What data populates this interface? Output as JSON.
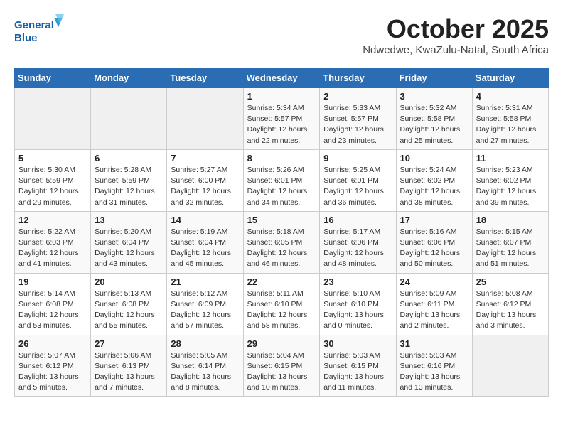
{
  "header": {
    "logo_line1": "General",
    "logo_line2": "Blue",
    "month": "October 2025",
    "location": "Ndwedwe, KwaZulu-Natal, South Africa"
  },
  "weekdays": [
    "Sunday",
    "Monday",
    "Tuesday",
    "Wednesday",
    "Thursday",
    "Friday",
    "Saturday"
  ],
  "weeks": [
    [
      {
        "day": "",
        "info": ""
      },
      {
        "day": "",
        "info": ""
      },
      {
        "day": "",
        "info": ""
      },
      {
        "day": "1",
        "info": "Sunrise: 5:34 AM\nSunset: 5:57 PM\nDaylight: 12 hours\nand 22 minutes."
      },
      {
        "day": "2",
        "info": "Sunrise: 5:33 AM\nSunset: 5:57 PM\nDaylight: 12 hours\nand 23 minutes."
      },
      {
        "day": "3",
        "info": "Sunrise: 5:32 AM\nSunset: 5:58 PM\nDaylight: 12 hours\nand 25 minutes."
      },
      {
        "day": "4",
        "info": "Sunrise: 5:31 AM\nSunset: 5:58 PM\nDaylight: 12 hours\nand 27 minutes."
      }
    ],
    [
      {
        "day": "5",
        "info": "Sunrise: 5:30 AM\nSunset: 5:59 PM\nDaylight: 12 hours\nand 29 minutes."
      },
      {
        "day": "6",
        "info": "Sunrise: 5:28 AM\nSunset: 5:59 PM\nDaylight: 12 hours\nand 31 minutes."
      },
      {
        "day": "7",
        "info": "Sunrise: 5:27 AM\nSunset: 6:00 PM\nDaylight: 12 hours\nand 32 minutes."
      },
      {
        "day": "8",
        "info": "Sunrise: 5:26 AM\nSunset: 6:01 PM\nDaylight: 12 hours\nand 34 minutes."
      },
      {
        "day": "9",
        "info": "Sunrise: 5:25 AM\nSunset: 6:01 PM\nDaylight: 12 hours\nand 36 minutes."
      },
      {
        "day": "10",
        "info": "Sunrise: 5:24 AM\nSunset: 6:02 PM\nDaylight: 12 hours\nand 38 minutes."
      },
      {
        "day": "11",
        "info": "Sunrise: 5:23 AM\nSunset: 6:02 PM\nDaylight: 12 hours\nand 39 minutes."
      }
    ],
    [
      {
        "day": "12",
        "info": "Sunrise: 5:22 AM\nSunset: 6:03 PM\nDaylight: 12 hours\nand 41 minutes."
      },
      {
        "day": "13",
        "info": "Sunrise: 5:20 AM\nSunset: 6:04 PM\nDaylight: 12 hours\nand 43 minutes."
      },
      {
        "day": "14",
        "info": "Sunrise: 5:19 AM\nSunset: 6:04 PM\nDaylight: 12 hours\nand 45 minutes."
      },
      {
        "day": "15",
        "info": "Sunrise: 5:18 AM\nSunset: 6:05 PM\nDaylight: 12 hours\nand 46 minutes."
      },
      {
        "day": "16",
        "info": "Sunrise: 5:17 AM\nSunset: 6:06 PM\nDaylight: 12 hours\nand 48 minutes."
      },
      {
        "day": "17",
        "info": "Sunrise: 5:16 AM\nSunset: 6:06 PM\nDaylight: 12 hours\nand 50 minutes."
      },
      {
        "day": "18",
        "info": "Sunrise: 5:15 AM\nSunset: 6:07 PM\nDaylight: 12 hours\nand 51 minutes."
      }
    ],
    [
      {
        "day": "19",
        "info": "Sunrise: 5:14 AM\nSunset: 6:08 PM\nDaylight: 12 hours\nand 53 minutes."
      },
      {
        "day": "20",
        "info": "Sunrise: 5:13 AM\nSunset: 6:08 PM\nDaylight: 12 hours\nand 55 minutes."
      },
      {
        "day": "21",
        "info": "Sunrise: 5:12 AM\nSunset: 6:09 PM\nDaylight: 12 hours\nand 57 minutes."
      },
      {
        "day": "22",
        "info": "Sunrise: 5:11 AM\nSunset: 6:10 PM\nDaylight: 12 hours\nand 58 minutes."
      },
      {
        "day": "23",
        "info": "Sunrise: 5:10 AM\nSunset: 6:10 PM\nDaylight: 13 hours\nand 0 minutes."
      },
      {
        "day": "24",
        "info": "Sunrise: 5:09 AM\nSunset: 6:11 PM\nDaylight: 13 hours\nand 2 minutes."
      },
      {
        "day": "25",
        "info": "Sunrise: 5:08 AM\nSunset: 6:12 PM\nDaylight: 13 hours\nand 3 minutes."
      }
    ],
    [
      {
        "day": "26",
        "info": "Sunrise: 5:07 AM\nSunset: 6:12 PM\nDaylight: 13 hours\nand 5 minutes."
      },
      {
        "day": "27",
        "info": "Sunrise: 5:06 AM\nSunset: 6:13 PM\nDaylight: 13 hours\nand 7 minutes."
      },
      {
        "day": "28",
        "info": "Sunrise: 5:05 AM\nSunset: 6:14 PM\nDaylight: 13 hours\nand 8 minutes."
      },
      {
        "day": "29",
        "info": "Sunrise: 5:04 AM\nSunset: 6:15 PM\nDaylight: 13 hours\nand 10 minutes."
      },
      {
        "day": "30",
        "info": "Sunrise: 5:03 AM\nSunset: 6:15 PM\nDaylight: 13 hours\nand 11 minutes."
      },
      {
        "day": "31",
        "info": "Sunrise: 5:03 AM\nSunset: 6:16 PM\nDaylight: 13 hours\nand 13 minutes."
      },
      {
        "day": "",
        "info": ""
      }
    ]
  ]
}
